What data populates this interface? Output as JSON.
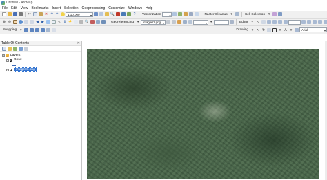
{
  "window": {
    "title": "Untitled - ArcMap"
  },
  "menu": [
    "File",
    "Edit",
    "View",
    "Bookmarks",
    "Insert",
    "Selection",
    "Geoprocessing",
    "Customize",
    "Windows",
    "Help"
  ],
  "toolbar1": {
    "scale": "1:10,000",
    "vectorization_label": "Vectorization",
    "raster_cleanup_label": "Raster Cleanup",
    "cell_selection_label": "Cell Selection"
  },
  "toolbar2": {
    "georeferencing_label": "Georeferencing",
    "layer_value": "image01.png",
    "editor_label": "Editor"
  },
  "toolbar3": {
    "snapping_label": "Snapping",
    "drawing_label": "Drawing",
    "font_value": "Arial"
  },
  "toc": {
    "title": "Table Of Contents",
    "group": "Layers",
    "layers": [
      {
        "name": "Road",
        "selected": false
      },
      {
        "name": "image01.png",
        "selected": true
      }
    ]
  },
  "colors": {
    "selection": "#3273d0",
    "toolbar_bg": "#f0f0f0",
    "raster_base": "#4d6b4e"
  }
}
